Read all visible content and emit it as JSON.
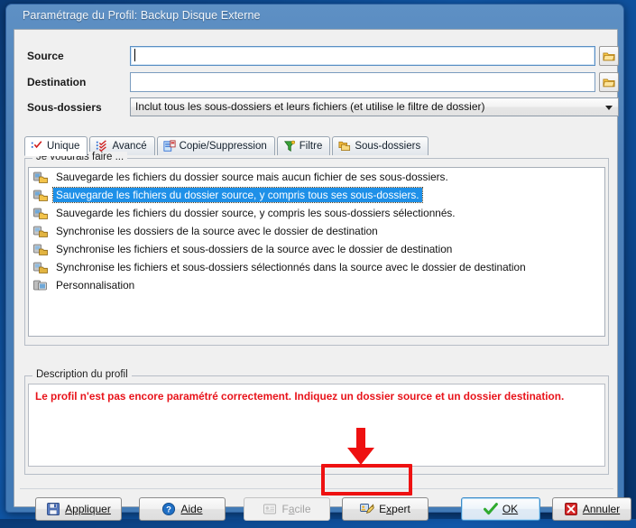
{
  "window": {
    "title": "Paramétrage du Profil: Backup Disque Externe"
  },
  "form": {
    "source_label": "Source",
    "source_value": "",
    "destination_label": "Destination",
    "destination_value": "",
    "subfolders_label": "Sous-dossiers",
    "subfolders_value": "Inclut tous les sous-dossiers et leurs fichiers (et utilise le filtre de dossier)",
    "browse_icon": "folder-icon"
  },
  "tabs": [
    {
      "label": "Unique",
      "icon": "checklist-icon",
      "active": true
    },
    {
      "label": "Avancé",
      "icon": "red-checklist-icon",
      "active": false
    },
    {
      "label": "Copie/Suppression",
      "icon": "copy-document-icon",
      "active": false
    },
    {
      "label": "Filtre",
      "icon": "funnel-icon",
      "active": false
    },
    {
      "label": "Sous-dossiers",
      "icon": "folders-icon",
      "active": false
    }
  ],
  "actions_group": {
    "title": "Je voudrais faire ...",
    "items": [
      {
        "label": "Sauvegarde les fichiers du dossier source mais aucun fichier de ses sous-dossiers.",
        "icon": "backup-folder-icon",
        "selected": false
      },
      {
        "label": "Sauvegarde les fichiers du dossier source, y compris tous ses sous-dossiers.",
        "icon": "backup-folder-icon",
        "selected": true
      },
      {
        "label": "Sauvegarde les fichiers du dossier source, y compris les sous-dossiers sélectionnés.",
        "icon": "backup-folder-icon",
        "selected": false
      },
      {
        "label": "Synchronise les dossiers de la source avec le dossier de destination",
        "icon": "sync-folder-icon",
        "selected": false
      },
      {
        "label": "Synchronise les fichiers et sous-dossiers de la source avec le dossier de destination",
        "icon": "sync-folder-icon",
        "selected": false
      },
      {
        "label": "Synchronise les fichiers et sous-dossiers sélectionnés dans la source avec le dossier de destination",
        "icon": "sync-folder-icon",
        "selected": false
      },
      {
        "label": "Personnalisation",
        "icon": "custom-folder-icon",
        "selected": false
      }
    ]
  },
  "description_group": {
    "title": "Description du profil",
    "text": "Le profil n'est pas encore paramétré correctement. Indiquez un dossier source et un dossier destination.",
    "text_color": "#e8131a"
  },
  "buttons": {
    "apply": {
      "label": "Appliquer",
      "icon": "save-disk-icon",
      "enabled": true
    },
    "help": {
      "label": "Aide",
      "icon": "question-circle-icon",
      "enabled": true
    },
    "easy": {
      "label": "Facile",
      "icon": "card-icon",
      "enabled": false
    },
    "expert": {
      "label": "Expert",
      "icon": "wizard-icon",
      "enabled": true,
      "highlighted": true
    },
    "ok": {
      "label": "OK",
      "icon": "green-check-icon",
      "enabled": true,
      "default": true
    },
    "cancel": {
      "label": "Annuler",
      "icon": "red-x-icon",
      "enabled": true
    }
  },
  "annotations": {
    "highlight_color": "#ee1111",
    "arrow": "down-arrow-annotation",
    "target": "Expert"
  }
}
